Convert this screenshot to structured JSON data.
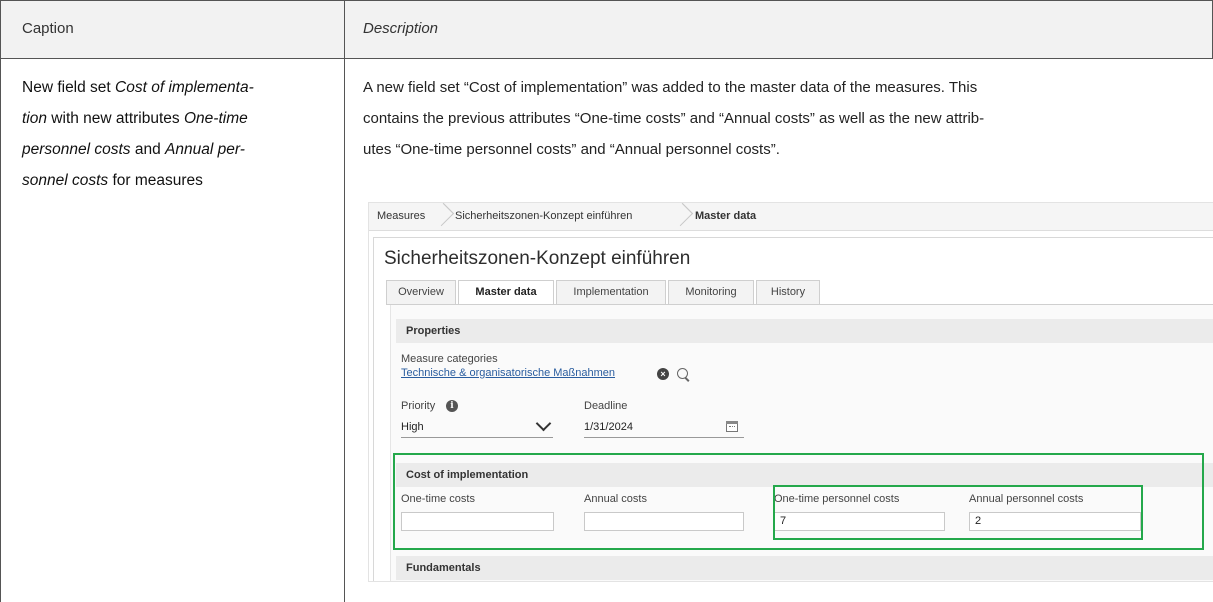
{
  "header": {
    "caption": "Caption",
    "description": "Description"
  },
  "caption": {
    "t1": "New field set ",
    "t2": "Cost of implementa-",
    "t3": "tion",
    "t4": " with new attributes ",
    "t5": "One-time",
    "t6": "personnel costs",
    "t7": " and ",
    "t8": "Annual per-",
    "t9": "sonnel costs",
    "t10": " for measures"
  },
  "description": {
    "line1": "A new field set “Cost of implementation” was added to the master data of the measures. This",
    "line2": "contains the previous attributes “One-time costs” and “Annual costs” as well as the new attrib-",
    "line3": "utes “One-time personnel costs” and “Annual personnel costs”."
  },
  "app": {
    "breadcrumb": [
      "Measures",
      "Sicherheitszonen-Konzept einführen",
      "Master data"
    ],
    "title": "Sicherheitszonen-Konzept einführen",
    "tabs": [
      "Overview",
      "Master data",
      "Implementation",
      "Monitoring",
      "History"
    ],
    "active_tab": "Master data",
    "properties": {
      "heading": "Properties",
      "measure_categories_label": "Measure categories",
      "measure_categories_value": "Technische & organisatorische Maßnahmen",
      "priority_label": "Priority",
      "priority_value": "High",
      "deadline_label": "Deadline",
      "deadline_value": "1/31/2024"
    },
    "cost": {
      "heading": "Cost of implementation",
      "one_time_label": "One-time costs",
      "one_time_value": "",
      "annual_label": "Annual costs",
      "annual_value": "",
      "one_time_personnel_label": "One-time personnel costs",
      "one_time_personnel_value": "7",
      "annual_personnel_label": "Annual personnel costs",
      "annual_personnel_value": "2"
    },
    "fundamentals": {
      "heading": "Fundamentals"
    },
    "highlight_color": "#24a84b"
  }
}
